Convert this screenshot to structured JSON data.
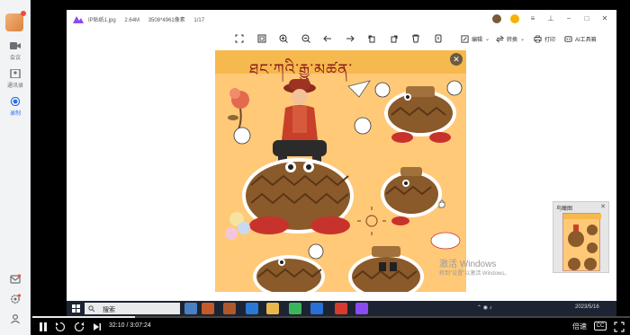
{
  "nav": {
    "items": [
      {
        "label": "会议",
        "icon": "video-icon"
      },
      {
        "label": "通讯录",
        "icon": "contacts-icon"
      },
      {
        "label": "录制",
        "icon": "record-icon"
      }
    ],
    "bottom_icons": [
      "mail-icon",
      "settings-icon",
      "user-icon"
    ],
    "accent": "#2f6fed"
  },
  "viewer": {
    "filename": "IP贴纸1.jpg",
    "filesize": "2.64M",
    "dimensions": "3508*4961像素",
    "page": "1/17",
    "toolbar_icons": [
      "fit-screen-icon",
      "actual-size-icon",
      "zoom-in-icon",
      "zoom-out-icon",
      "previous-icon",
      "next-icon",
      "rotate-left-icon",
      "rotate-right-icon",
      "delete-icon",
      "info-icon"
    ],
    "actions": {
      "edit": "编辑",
      "convert": "转换",
      "print": "打印",
      "ai": "AI工具箱"
    },
    "art_title": "ཐང་ཀའི་རྒྱུ་མཚན་",
    "preview_title": "鸟瞰图"
  },
  "watermark": {
    "line1": "激活 Windows",
    "line2": "转到\"设置\"以激活 Windows。"
  },
  "taskbar": {
    "search_label": "搜索",
    "time": "2023/5/16"
  },
  "video": {
    "current": "32:10",
    "total": "3:07:24",
    "separator": "/",
    "speed": "倍速",
    "cc": "CC",
    "progress": 0.1715
  }
}
